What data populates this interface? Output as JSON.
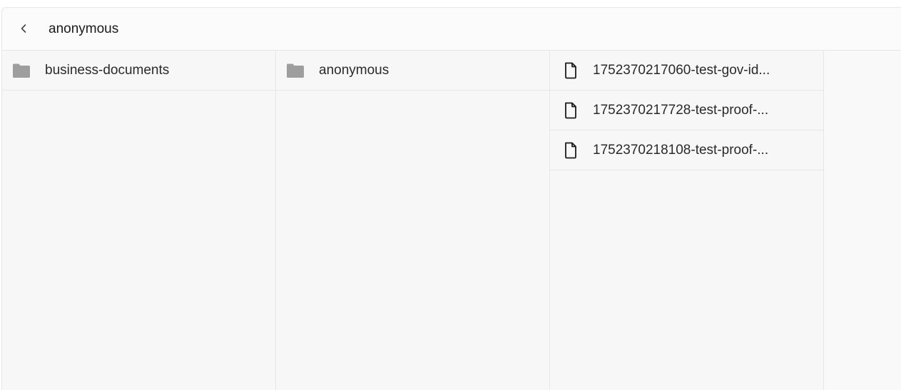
{
  "header": {
    "title": "anonymous",
    "back_icon": "chevron-left-icon"
  },
  "columns": [
    {
      "items": [
        {
          "type": "folder",
          "icon": "folder-icon",
          "label": "business-documents"
        }
      ]
    },
    {
      "items": [
        {
          "type": "folder",
          "icon": "folder-icon",
          "label": "anonymous"
        }
      ]
    },
    {
      "items": [
        {
          "type": "file",
          "icon": "file-icon",
          "label": "1752370217060-test-gov-id..."
        },
        {
          "type": "file",
          "icon": "file-icon",
          "label": "1752370217728-test-proof-..."
        },
        {
          "type": "file",
          "icon": "file-icon",
          "label": "1752370218108-test-proof-..."
        }
      ]
    }
  ],
  "colors": {
    "folder": "#9e9e9e",
    "file_stroke": "#1a1a1a",
    "border": "#e6e6e6",
    "column_bg": "#f7f7f7"
  }
}
